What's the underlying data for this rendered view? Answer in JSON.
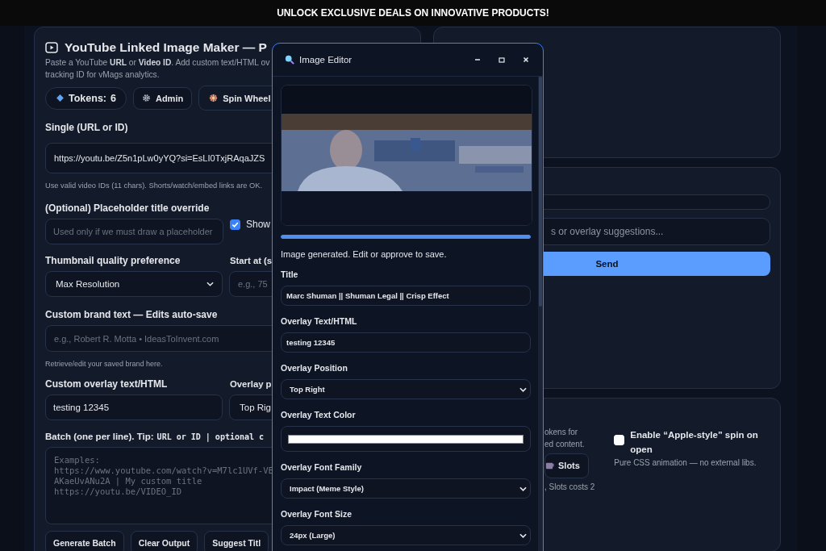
{
  "banner": {
    "text": "UNLOCK EXCLUSIVE DEALS ON INNOVATIVE PRODUCTS!"
  },
  "maker": {
    "title": "YouTube Linked Image Maker — P",
    "description": [
      "Paste a YouTube **URL** or **Video ID**. Add custom text/HTML ov",
      "tracking ID for vMags analytics."
    ],
    "tokens": {
      "label": "Tokens:",
      "count": "6"
    },
    "buttons": [
      {
        "kind": "admin",
        "label": "Admin"
      },
      {
        "kind": "wheel",
        "label": "Spin Wheel"
      }
    ],
    "single": {
      "label": "Single (URL or ID)",
      "value": "https://youtu.be/Z5n1pLw0yYQ?si=EsLI0TxjRAqaJZS",
      "hint": "Use valid video IDs (11 chars). Shorts/watch/embed links are OK."
    },
    "placeholder_title": {
      "label": "(Optional) Placeholder title override",
      "placeholder": "Used only if we must draw a placeholder"
    },
    "show": {
      "label": "Show",
      "checked": true
    },
    "quality": {
      "label": "Thumbnail quality preference",
      "value": "Max Resolution"
    },
    "start": {
      "label": "Start at (s",
      "placeholder": "e.g., 75"
    },
    "brand": {
      "label": "Custom brand text — Edits auto-save",
      "placeholder": "e.g., Robert R. Motta • IdeasToInvent.com",
      "hint": "Retrieve/edit your saved brand here."
    },
    "overlay": {
      "label": "Custom overlay text/HTML",
      "value": "testing 12345"
    },
    "overlay_position": {
      "label": "Overlay p",
      "value": "Top Rig"
    },
    "batch": {
      "label": "Batch (one per line). Tip:",
      "tip": "URL or ID | optional c",
      "placeholder": "Examples:\nhttps://www.youtube.com/watch?v=M7lc1UVf-VE\nAKaeUvANu2A | My custom title\nhttps://youtu.be/VIDEO_ID"
    },
    "actions": [
      "Generate Batch",
      "Clear Output",
      "Suggest Titl"
    ]
  },
  "chat": {
    "placeholder": "s or overlay suggestions...",
    "send": "Send"
  },
  "games": {
    "text": [
      "okens for",
      "ed content."
    ],
    "slots": "Slots",
    "cost": ", Slots costs 2",
    "spin": {
      "label": "Enable “Apple-style” spin on open",
      "checked": false,
      "hint": "Pure CSS animation — no external libs."
    }
  },
  "editor": {
    "title": "Image Editor",
    "progress": {
      "level": 1
    },
    "status": "Image generated. Edit or approve to save.",
    "fields": [
      {
        "kind": "text",
        "label": "Title",
        "value": "Marc Shuman || Shuman Legal || Crisp Effect"
      },
      {
        "kind": "text",
        "label": "Overlay Text/HTML",
        "value": "testing 12345"
      },
      {
        "kind": "select",
        "label": "Overlay Position",
        "value": "Top Right"
      },
      {
        "kind": "color",
        "label": "Overlay Text Color",
        "color": "#ffffff"
      },
      {
        "kind": "select",
        "label": "Overlay Font Family",
        "value": "Impact (Meme Style)"
      },
      {
        "kind": "select",
        "label": "Overlay Font Size",
        "value": "24px (Large)"
      }
    ]
  }
}
